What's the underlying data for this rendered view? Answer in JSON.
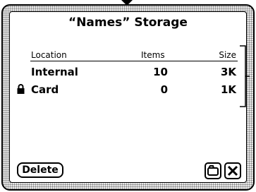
{
  "dialog": {
    "title": "“Names” Storage"
  },
  "table": {
    "headers": {
      "location": "Location",
      "items": "Items",
      "size": "Size"
    },
    "rows": [
      {
        "location": "Internal",
        "items": "10",
        "size": "3K",
        "locked": false
      },
      {
        "location": "Card",
        "items": "0",
        "size": "1K",
        "locked": true
      }
    ]
  },
  "buttons": {
    "delete_label": "Delete"
  },
  "icons": {
    "lock": "lock-icon",
    "folder": "folder-icon",
    "close": "close-icon"
  }
}
